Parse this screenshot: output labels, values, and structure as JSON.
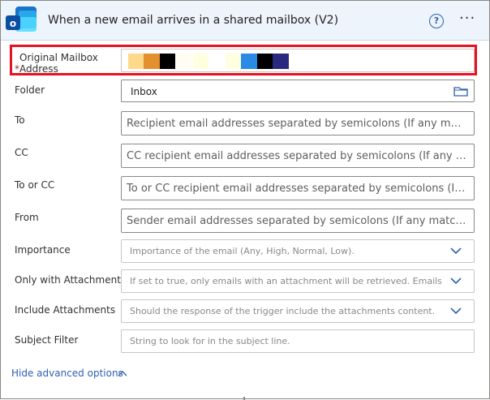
{
  "header": {
    "title": "When a new email arrives in a shared mailbox (V2)",
    "help_icon": "question-circle-icon",
    "more_icon": "ellipsis-icon",
    "app_icon": "outlook-icon"
  },
  "fields": {
    "mailbox": {
      "required_mark": "*",
      "label": "Original Mailbox Address",
      "value_redacted": true
    },
    "folder": {
      "label": "Folder",
      "value": "Inbox",
      "icon": "folder-icon"
    },
    "to": {
      "label": "To",
      "placeholder": "Recipient email addresses separated by semicolons (If any match, t..."
    },
    "cc": {
      "label": "CC",
      "placeholder": "CC recipient email addresses separated by semicolons (If any matc..."
    },
    "to_or_cc": {
      "label": "To or CC",
      "placeholder": "To or CC recipient email addresses separated by semicolons (If any ..."
    },
    "from": {
      "label": "From",
      "placeholder": "Sender email addresses separated by semicolons (If any match, the..."
    },
    "importance": {
      "label": "Importance",
      "placeholder": "Importance of the email (Any, High, Normal, Low)."
    },
    "only_attachments": {
      "label": "Only with Attachments",
      "placeholder": "If set to true, only emails with an attachment will be retrieved. Emails witl"
    },
    "include_attachments": {
      "label": "Include Attachments",
      "placeholder": "Should the response of the trigger include the attachments content."
    },
    "subject_filter": {
      "label": "Subject Filter",
      "placeholder": "String to look for in the subject line."
    }
  },
  "advanced": {
    "label": "Hide advanced options",
    "icon": "chevron-up-icon"
  },
  "colors": {
    "accent": "#2f5fb3",
    "highlight_border": "#e81123",
    "header_bg": "#eef4fb"
  }
}
